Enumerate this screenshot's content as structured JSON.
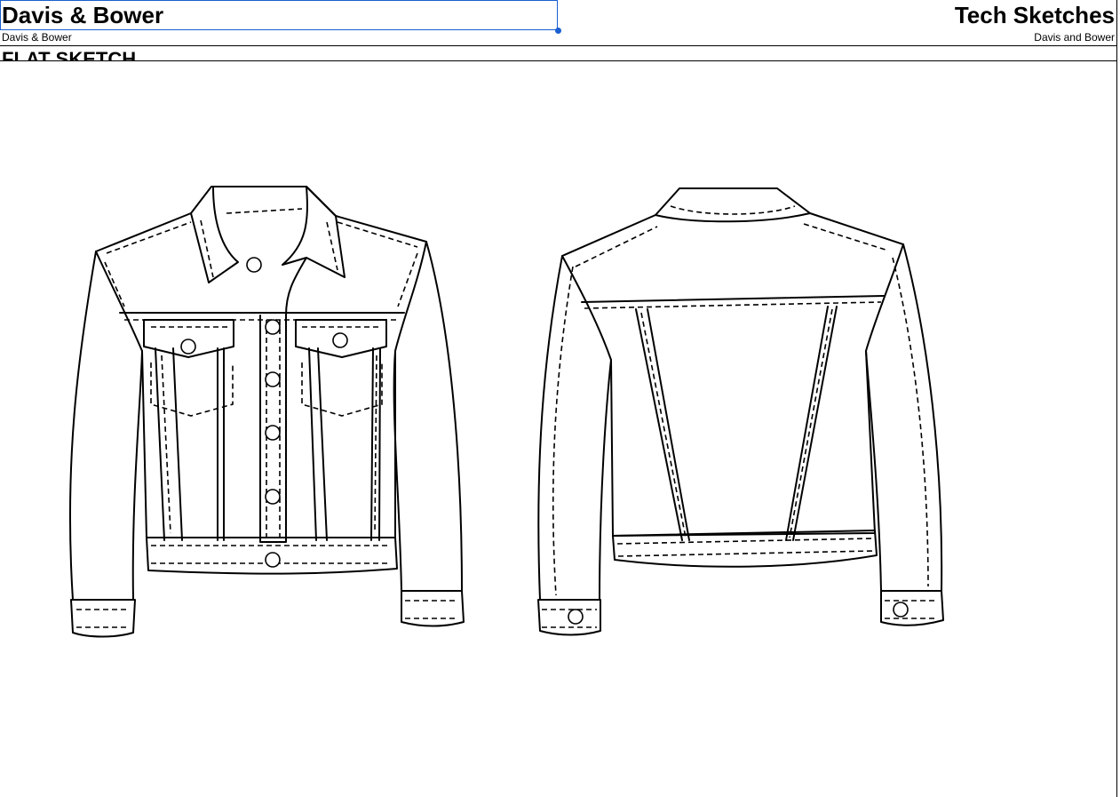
{
  "header": {
    "brand_title": "Davis & Bower",
    "brand_subtitle": "Davis & Bower",
    "doc_title": "Tech Sketches",
    "doc_subtitle": "Davis and Bower"
  },
  "section": {
    "title": "FLAT SKETCH"
  },
  "colors": {
    "selection": "#1a5fd0",
    "line": "#000000",
    "background": "#ffffff"
  }
}
